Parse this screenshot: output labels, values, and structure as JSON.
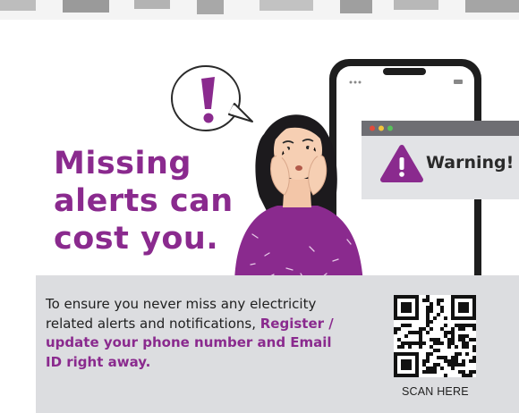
{
  "colors": {
    "accent": "#8a2a8e",
    "panel": "#dcdde0",
    "phone_frame": "#1e1e1e",
    "warning_window": "#e2e3e6",
    "warning_titlebar": "#6e6e73"
  },
  "headline": {
    "line1": "Missing",
    "line2": "alerts can",
    "line3": "cost you."
  },
  "warning": {
    "label": "Warning!",
    "icon": "warning-triangle-icon"
  },
  "speech_bubble": {
    "icon": "exclamation-icon"
  },
  "body": {
    "intro": "To ensure you never miss any electricity related alerts and notifications, ",
    "cta": "Register / update your phone number and Email ID right away."
  },
  "qr": {
    "icon": "qr-code-icon",
    "caption": "SCAN HERE"
  }
}
